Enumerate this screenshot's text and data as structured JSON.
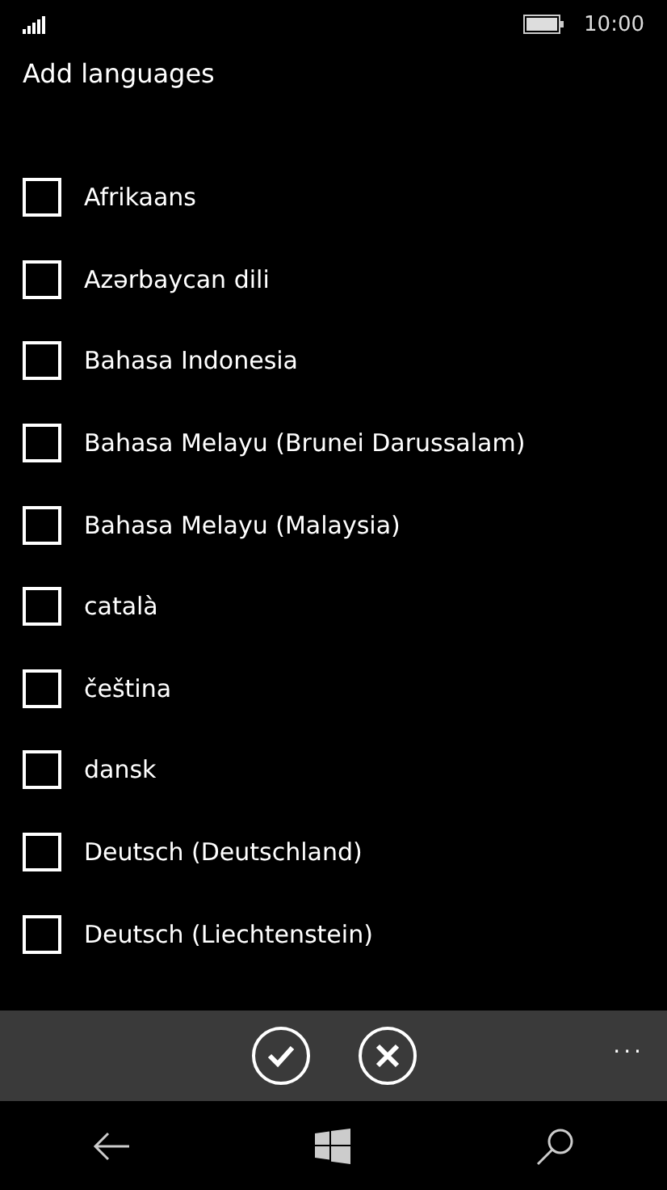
{
  "status_bar": {
    "time": "10:00"
  },
  "title": "Add languages",
  "languages": [
    {
      "label": "Afrikaans",
      "checked": false
    },
    {
      "label": "Azərbaycan dili",
      "checked": false
    },
    {
      "label": "Bahasa Indonesia",
      "checked": false
    },
    {
      "label": "Bahasa Melayu (Brunei Darussalam)",
      "checked": false
    },
    {
      "label": "Bahasa Melayu (Malaysia)",
      "checked": false
    },
    {
      "label": "català",
      "checked": false
    },
    {
      "label": "čeština",
      "checked": false
    },
    {
      "label": "dansk",
      "checked": false
    },
    {
      "label": "Deutsch (Deutschland)",
      "checked": false
    },
    {
      "label": "Deutsch (Liechtenstein)",
      "checked": false
    }
  ],
  "app_bar": {
    "more": "..."
  }
}
